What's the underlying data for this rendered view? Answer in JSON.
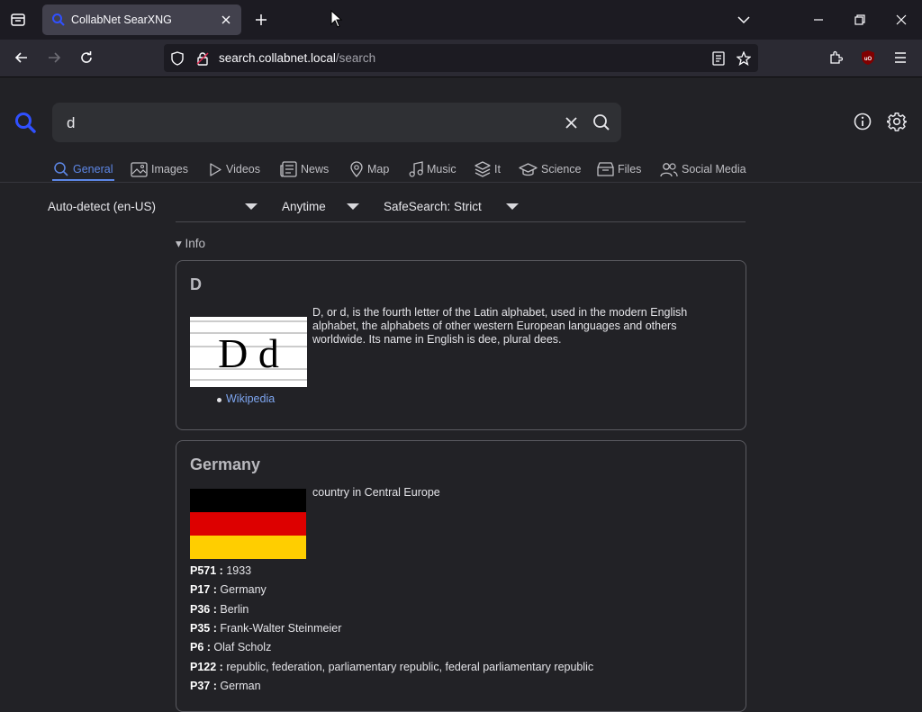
{
  "browser": {
    "tab_title": "CollabNet SearXNG",
    "url_host": "search.collabnet.local",
    "url_path": "/search"
  },
  "search": {
    "query": "d"
  },
  "categories": [
    {
      "label": "General",
      "icon": "search-icon"
    },
    {
      "label": "Images",
      "icon": "image-icon"
    },
    {
      "label": "Videos",
      "icon": "play-icon"
    },
    {
      "label": "News",
      "icon": "newspaper-icon"
    },
    {
      "label": "Map",
      "icon": "map-pin-icon"
    },
    {
      "label": "Music",
      "icon": "music-note-icon"
    },
    {
      "label": "It",
      "icon": "layers-icon"
    },
    {
      "label": "Science",
      "icon": "graduation-cap-icon"
    },
    {
      "label": "Files",
      "icon": "archive-icon"
    },
    {
      "label": "Social Media",
      "icon": "people-icon"
    }
  ],
  "filters": {
    "language": "Auto-detect (en-US)",
    "time": "Anytime",
    "safesearch": "SafeSearch: Strict"
  },
  "info_toggle": "▾ Info",
  "infobox_d": {
    "title": "D",
    "image_text": "D d",
    "description": "D, or d, is the fourth letter of the Latin alphabet, used in the modern English alphabet, the alphabets of other western European languages and others worldwide. Its name in English is dee, plural dees.",
    "link": "Wikipedia"
  },
  "infobox_germany": {
    "title": "Germany",
    "description": "country in Central Europe",
    "flag_colors": [
      "#000000",
      "#dd0000",
      "#ffce00"
    ],
    "attributes": [
      {
        "key": "P571 :",
        "value": "1933"
      },
      {
        "key": "P17 :",
        "value": "Germany"
      },
      {
        "key": "P36 :",
        "value": "Berlin"
      },
      {
        "key": "P35 :",
        "value": "Frank-Walter Steinmeier"
      },
      {
        "key": "P6 :",
        "value": "Olaf Scholz"
      },
      {
        "key": "P122 :",
        "value": "republic, federation, parliamentary republic, federal parliamentary republic"
      },
      {
        "key": "P37 :",
        "value": "German"
      }
    ]
  },
  "colors": {
    "accent": "#5d87e6",
    "page_bg": "#222226",
    "chrome_bg": "#2b2a33"
  }
}
